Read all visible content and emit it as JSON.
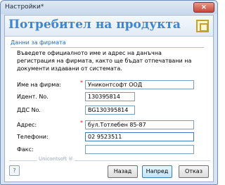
{
  "window": {
    "title": "Настройки*",
    "close_icon": "×"
  },
  "header": {
    "title": "Потребител на продукта"
  },
  "section": {
    "title": "Данни за фирмата",
    "description": "Въведете официалното име и адрес на данъчна регистрация на фирмата, както ще бъдат отпечатвани на документи издавани от системата."
  },
  "form": {
    "company_name": {
      "label": "Име на фирма:",
      "required_mark": "*",
      "value": "Униконтсофт ООД"
    },
    "ident_no": {
      "label": "Идент. No.",
      "value": "130395814"
    },
    "vat_no": {
      "label": "ДДС No.",
      "value": "BG130395814"
    },
    "address": {
      "label": "Адрес:",
      "required_mark": "*",
      "value": "бул.Тотлебен 85-87"
    },
    "phones": {
      "label": "Телефони:",
      "value": "02 9523511"
    },
    "fax": {
      "label": "Факс:",
      "value": ""
    }
  },
  "footer": {
    "brand": "Unicontsoft ®",
    "help_icon": "?",
    "back_label": "Назад",
    "next_label": "Напред",
    "cancel_label": "Отказ"
  }
}
